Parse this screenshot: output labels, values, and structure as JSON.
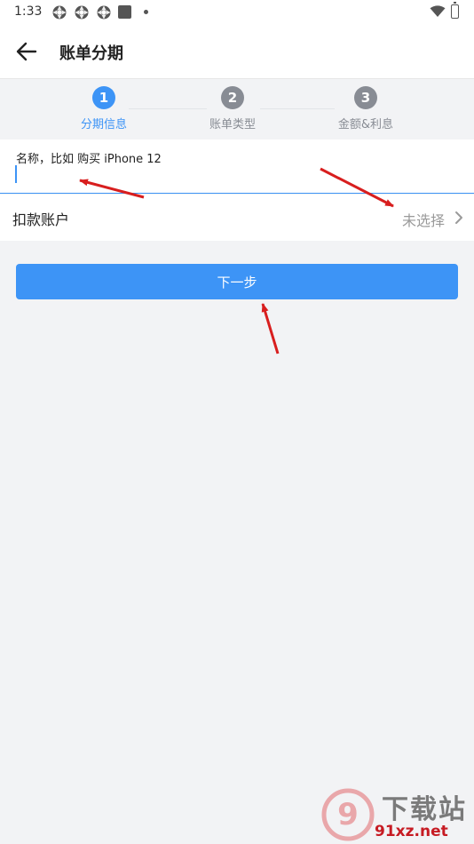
{
  "status_bar": {
    "time": "1:33",
    "notification_icons": [
      "notification-icon",
      "notification-icon",
      "notification-icon",
      "square-app-icon",
      "dot-icon"
    ],
    "right_icons": [
      "wifi-icon",
      "battery-icon"
    ]
  },
  "app_bar": {
    "title": "账单分期",
    "back_icon": "arrow-left-icon"
  },
  "stepper": {
    "steps": [
      {
        "number": "1",
        "label": "分期信息",
        "state": "active"
      },
      {
        "number": "2",
        "label": "账单类型",
        "state": "inactive"
      },
      {
        "number": "3",
        "label": "金额&利息",
        "state": "inactive"
      }
    ]
  },
  "form": {
    "name_field": {
      "hint": "名称，比如 购买 iPhone 12",
      "value": ""
    },
    "account_row": {
      "label": "扣款账户",
      "value": "未选择",
      "chevron": "chevron-right-icon"
    }
  },
  "actions": {
    "next_label": "下一步"
  },
  "watermark": {
    "logo_text": "9",
    "title": "下载站",
    "url": "91xz.net"
  },
  "colors": {
    "primary": "#3d94f6",
    "inactive_step": "#888c94",
    "page_background": "#f2f3f5",
    "annotation_arrow": "#d81e1e",
    "watermark_red": "#c61b23"
  }
}
